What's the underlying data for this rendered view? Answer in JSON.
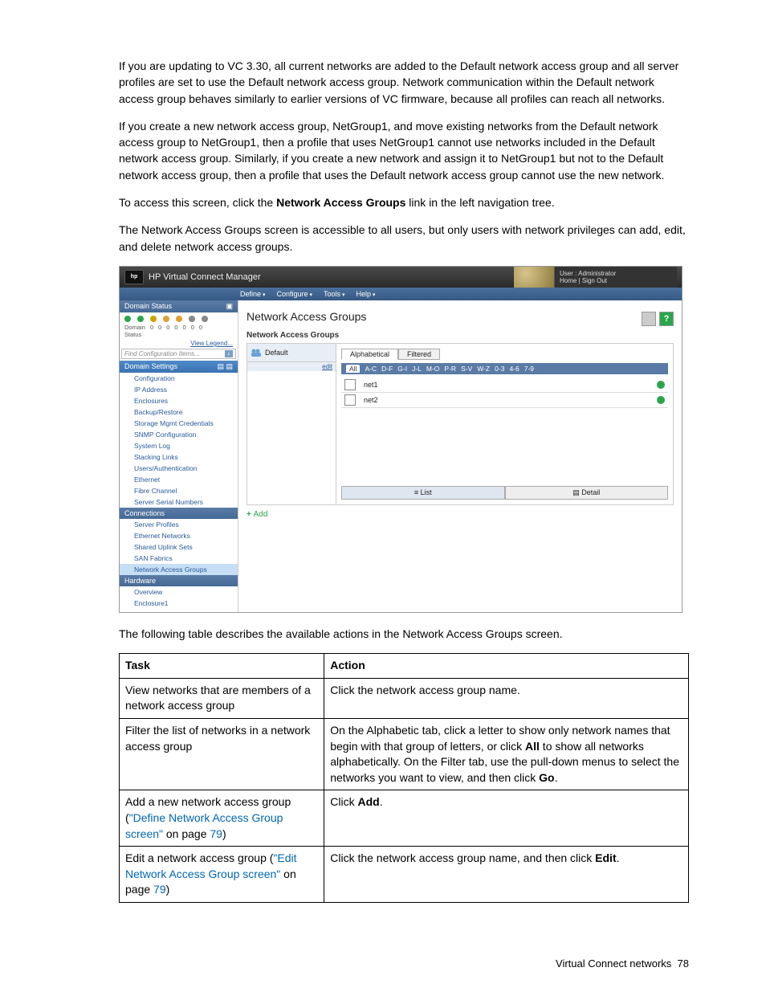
{
  "paragraphs": {
    "p1": "If you are updating to VC 3.30, all current networks are added to the Default network access group and all server profiles are set to use the Default network access group. Network communication within the Default network access group behaves similarly to earlier versions of VC firmware, because all profiles can reach all networks.",
    "p2": "If you create a new network access group, NetGroup1, and move existing networks from the Default network access group to NetGroup1, then a profile that uses NetGroup1 cannot use networks included in the Default network access group. Similarly, if you create a new network and assign it to NetGroup1 but not to the Default network access group, then a profile that uses the Default network access group cannot use the new network.",
    "p3_pre": "To access this screen, click the ",
    "p3_bold": "Network Access Groups",
    "p3_post": " link in the left navigation tree.",
    "p4": "The Network Access Groups screen is accessible to all users, but only users with network privileges can add, edit, and delete network access groups.",
    "p5": "The following table describes the available actions in the Network Access Groups screen."
  },
  "screenshot": {
    "title": "HP Virtual Connect Manager",
    "logo": "hp",
    "user_label": "User : Administrator",
    "user_links": "Home  |  Sign Out",
    "menu": [
      "Define",
      "Configure",
      "Tools",
      "Help"
    ],
    "left": {
      "domain_status": "Domain Status",
      "domain_row": "Domain Status",
      "view_legend": "View Legend...",
      "find_placeholder": "Find Configuration Items...",
      "domain_settings": "Domain Settings",
      "nav_items": [
        "Configuration",
        "IP Address",
        "Enclosures",
        "Backup/Restore",
        "Storage Mgmt Credentials",
        "SNMP Configuration",
        "System Log",
        "Stacking Links",
        "Users/Authentication",
        "Ethernet",
        "Fibre Channel",
        "Server Serial Numbers"
      ],
      "connections_hdr": "Connections",
      "conn_items": [
        "Server Profiles",
        "Ethernet Networks",
        "Shared Uplink Sets",
        "SAN Fabrics",
        "Network Access Groups"
      ],
      "hardware_hdr": "Hardware",
      "hw_items": [
        "Overview",
        "Enclosure1"
      ]
    },
    "main": {
      "heading": "Network Access Groups",
      "subheading": "Network Access Groups",
      "default_label": "Default",
      "edit_link": "edit",
      "tabs": [
        "Alphabetical",
        "Filtered"
      ],
      "alpha": [
        "All",
        "A-C",
        "D-F",
        "G-I",
        "J-L",
        "M-O",
        "P-R",
        "S-V",
        "W-Z",
        "0-3",
        "4-6",
        "7-9"
      ],
      "nets": [
        "net1",
        "net2"
      ],
      "footer_tabs": [
        "List",
        "Detail"
      ],
      "add": "Add",
      "help_icon": "?"
    }
  },
  "table": {
    "headers": [
      "Task",
      "Action"
    ],
    "rows": [
      {
        "task": "View networks that are members of a network access group",
        "action_parts": [
          {
            "t": "Click the network access group name."
          }
        ]
      },
      {
        "task": "Filter the list of networks in a network access group",
        "action_parts": [
          {
            "t": "On the Alphabetic tab, click a letter to show only network names that begin with that group of letters, or click "
          },
          {
            "b": "All"
          },
          {
            "t": " to show all networks alphabetically. On the Filter tab, use the pull-down menus to select the networks you want to view, and then click "
          },
          {
            "b": "Go"
          },
          {
            "t": "."
          }
        ]
      },
      {
        "task_parts": [
          {
            "t": "Add a new network access group ("
          },
          {
            "l": "\"Define Network Access Group screen\""
          },
          {
            "t": " on page "
          },
          {
            "l": "79"
          },
          {
            "t": ")"
          }
        ],
        "action_parts": [
          {
            "t": "Click "
          },
          {
            "b": "Add"
          },
          {
            "t": "."
          }
        ]
      },
      {
        "task_parts": [
          {
            "t": "Edit a network access group ("
          },
          {
            "l": "\"Edit Network Access Group screen\""
          },
          {
            "t": " on page "
          },
          {
            "l": "79"
          },
          {
            "t": ")"
          }
        ],
        "action_parts": [
          {
            "t": "Click the network access group name, and then click "
          },
          {
            "b": "Edit"
          },
          {
            "t": "."
          }
        ]
      }
    ]
  },
  "footer": {
    "text": "Virtual Connect networks",
    "page": "78"
  }
}
